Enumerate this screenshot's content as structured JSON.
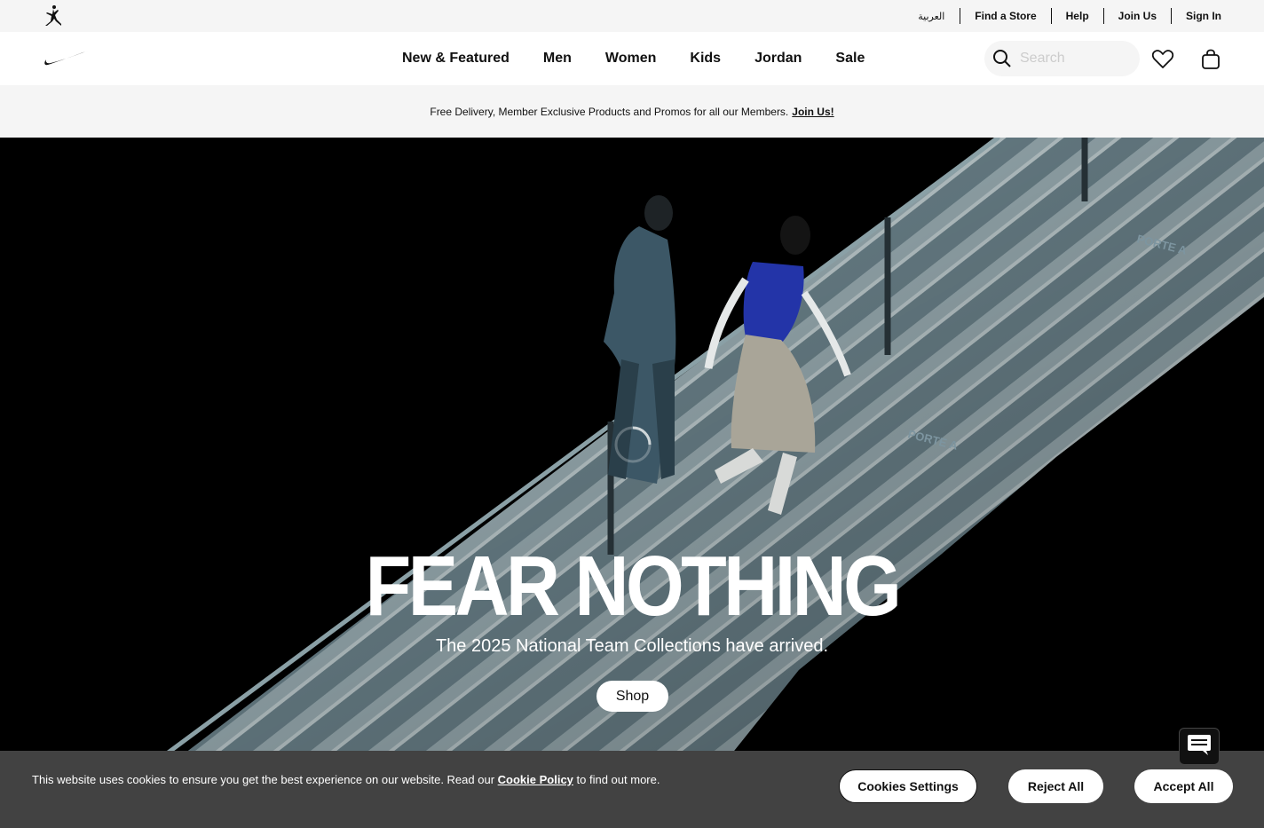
{
  "utility_bar": {
    "links": [
      "العربية",
      "Find a Store",
      "Help",
      "Join Us",
      "Sign In"
    ]
  },
  "nav": {
    "items": [
      "New & Featured",
      "Men",
      "Women",
      "Kids",
      "Jordan",
      "Sale"
    ],
    "search_placeholder": "Search"
  },
  "promo": {
    "text": "Free Delivery, Member Exclusive Products and Promos for all our Members.",
    "link": "Join Us!"
  },
  "hero": {
    "title": "FEAR NOTHING",
    "subtitle": "The 2025 National Team Collections have arrived.",
    "button": "Shop",
    "stair_signs": [
      "PORTE A",
      "PORTE A"
    ]
  },
  "cookie": {
    "text_before": "This website uses cookies to ensure you get the best experience on our website. Read our",
    "policy_link": "Cookie Policy",
    "text_after": "to find out more.",
    "settings_button": "Cookies Settings",
    "reject_button": "Reject All",
    "accept_button": "Accept All"
  },
  "colors": {
    "utility_bg": "#f5f5f5",
    "hero_bg": "#000000",
    "cookie_bg": "#424242",
    "text": "#111111"
  },
  "icons": [
    "jordan-jumpman-icon",
    "nike-swoosh-icon",
    "search-icon",
    "heart-icon",
    "bag-icon",
    "loading-spinner-icon",
    "chat-icon"
  ]
}
